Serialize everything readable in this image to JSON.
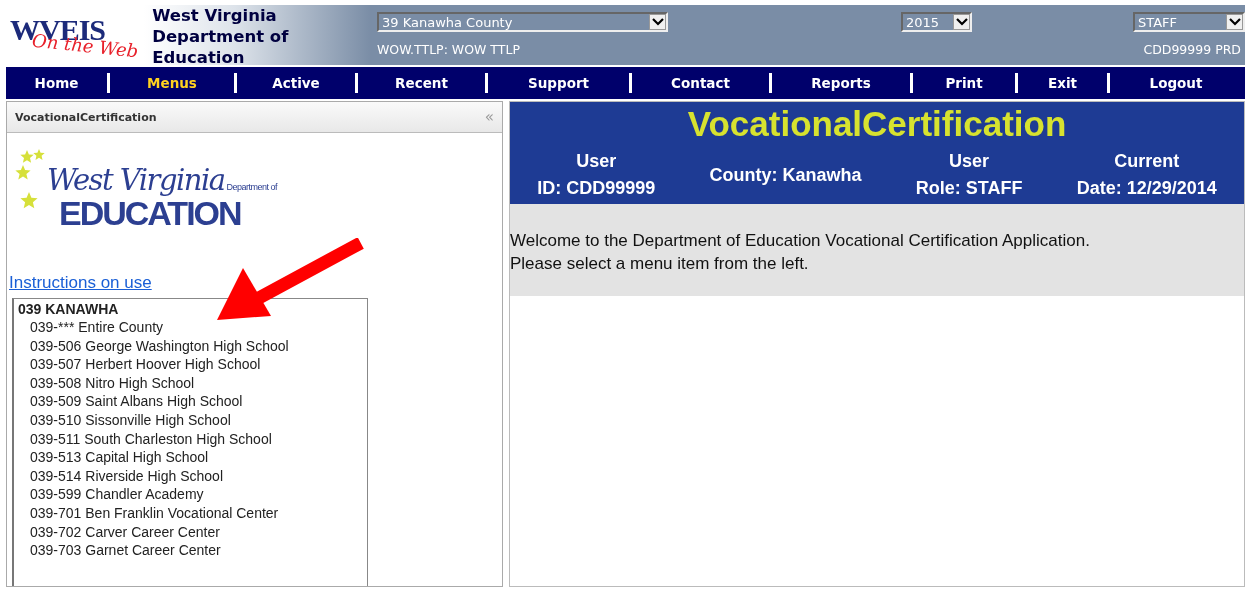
{
  "header": {
    "logo": {
      "title": "WVEIS",
      "subtitle": "On the Web"
    },
    "agency": "West Virginia Department of Education",
    "county_select": {
      "value": "39 Kanawha County"
    },
    "year_select": {
      "value": "2015"
    },
    "role_select": {
      "value": "STAFF"
    },
    "app_code": "WOW.TTLP: WOW TTLP",
    "user_env": "CDD99999 PRD"
  },
  "nav": [
    {
      "label": "Home",
      "selected": false
    },
    {
      "label": "Menus",
      "selected": true
    },
    {
      "label": "Active",
      "selected": false
    },
    {
      "label": "Recent",
      "selected": false
    },
    {
      "label": "Support",
      "selected": false
    },
    {
      "label": "Contact",
      "selected": false
    },
    {
      "label": "Reports",
      "selected": false
    },
    {
      "label": "Print",
      "selected": false
    },
    {
      "label": "Exit",
      "selected": false
    },
    {
      "label": "Logout",
      "selected": false
    }
  ],
  "sidebar": {
    "title": "VocationalCertification",
    "collapse": "«",
    "logo": {
      "state": "West Virginia",
      "dept": "Department of",
      "agency": "EDUCATION"
    },
    "instructions_link": "Instructions on use",
    "school_list": {
      "header": "039 KANAWHA",
      "items": [
        "039-*** Entire County",
        "039-506 George Washington High School",
        "039-507 Herbert Hoover High School",
        "039-508 Nitro High School",
        "039-509 Saint Albans High School",
        "039-510 Sissonville High School",
        "039-511 South Charleston High School",
        "039-513 Capital High School",
        "039-514 Riverside High School",
        "039-599 Chandler Academy",
        "039-701 Ben Franklin Vocational Center",
        "039-702 Carver Career Center",
        "039-703 Garnet Career Center"
      ]
    }
  },
  "main": {
    "title": "VocationalCertification",
    "info": [
      {
        "lines": [
          "User",
          "ID: CDD99999"
        ]
      },
      {
        "lines": [
          "County: Kanawha"
        ]
      },
      {
        "lines": [
          "User",
          "Role: STAFF"
        ]
      },
      {
        "lines": [
          "Current",
          "Date: 12/29/2014"
        ]
      }
    ],
    "welcome": [
      "Welcome to the Department of Education Vocational Certification Application.",
      "Please select a menu item from the left."
    ]
  },
  "annotation": {
    "kind": "arrow"
  }
}
